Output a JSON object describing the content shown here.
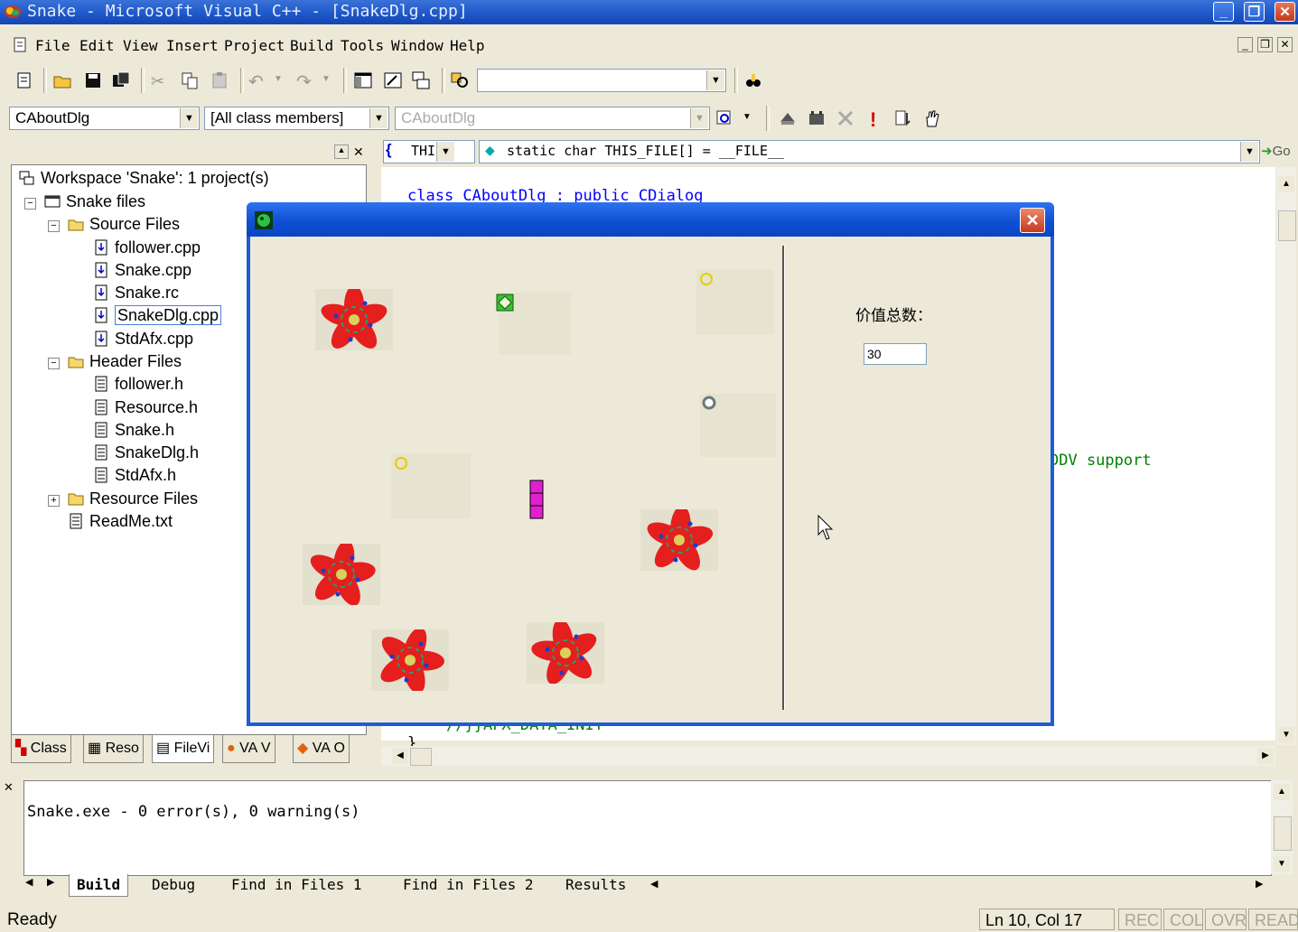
{
  "window": {
    "title": "Snake - Microsoft Visual C++ - [SnakeDlg.cpp]"
  },
  "menu": [
    "File",
    "Edit",
    "View",
    "Insert",
    "Project",
    "Build",
    "Tools",
    "Window",
    "Help"
  ],
  "wizardbar": {
    "class_combo": "CAboutDlg",
    "filter_combo": "[All class members]",
    "members_combo": "CAboutDlg"
  },
  "pane_header": {
    "scope": "THI",
    "symbol": "static char THIS_FILE[] = __FILE__",
    "go_label": "Go"
  },
  "workspace": {
    "root": "Workspace 'Snake': 1 project(s)",
    "project": "Snake files",
    "source_folder": "Source Files",
    "source_files": [
      "follower.cpp",
      "Snake.cpp",
      "Snake.rc",
      "SnakeDlg.cpp",
      "StdAfx.cpp"
    ],
    "header_folder": "Header Files",
    "header_files": [
      "follower.h",
      "Resource.h",
      "Snake.h",
      "SnakeDlg.h",
      "StdAfx.h"
    ],
    "resource_folder": "Resource Files",
    "readme": "ReadMe.txt",
    "tabs": [
      "Class",
      "Reso",
      "FileVi",
      "VA V",
      "VA O"
    ]
  },
  "editor": {
    "line1": "class CAboutDlg : public CDialog",
    "ddv_fragment": "DDV support",
    "bottom_fragment": "//}}AFX_DATA_INIT",
    "brace": "}"
  },
  "dialog": {
    "value_label": "价值总数：",
    "value_input": "30"
  },
  "output": {
    "message": "Snake.exe - 0 error(s), 0 warning(s)",
    "tabs": [
      "Build",
      "Debug",
      "Find in Files 1",
      "Find in Files 2",
      "Results"
    ]
  },
  "status": {
    "text": "Ready",
    "position": "Ln 10, Col 17",
    "indicators": [
      "REC",
      "COL",
      "OVR",
      "READ"
    ]
  },
  "colors": {
    "titlebar": "#1d56c8",
    "code_keyword": "#0000ff",
    "code_comment": "#008000",
    "flower_red": "#e51e1e"
  }
}
